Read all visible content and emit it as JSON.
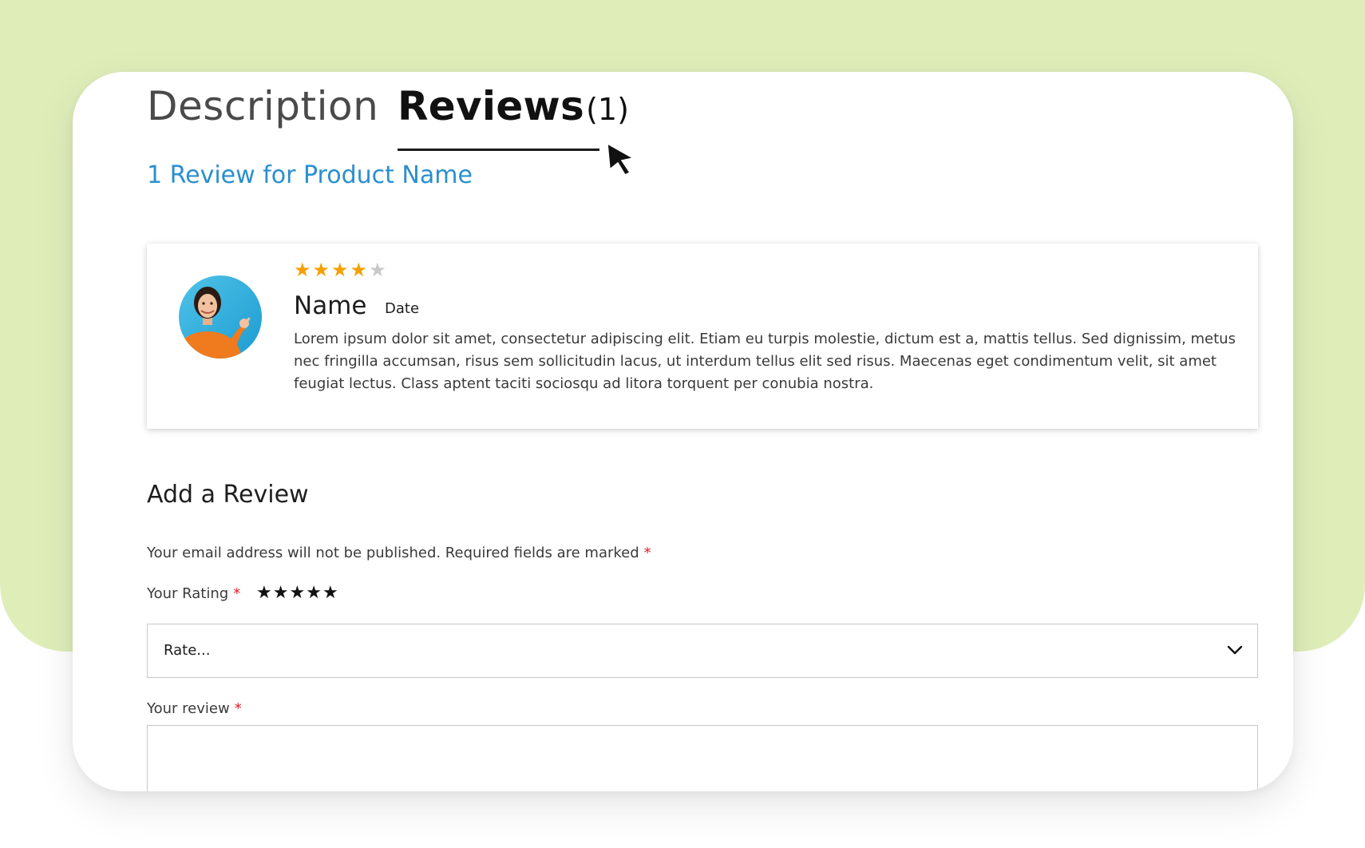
{
  "tabs": {
    "description_label": "Description",
    "reviews_label": "Reviews",
    "reviews_count": "(1)"
  },
  "reviews_section": {
    "title": "1 Review for Product Name"
  },
  "review": {
    "rating": 4,
    "max_rating": 5,
    "name": "Name",
    "date": "Date",
    "text": "Lorem ipsum dolor sit amet, consectetur adipiscing elit. Etiam eu turpis molestie, dictum est a, mattis tellus. Sed dignissim, metus nec fringilla accumsan, risus sem sollicitudin lacus, ut interdum tellus elit sed risus. Maecenas eget condimentum velit, sit amet feugiat lectus. Class aptent taciti sociosqu ad litora torquent per conubia nostra."
  },
  "add_review": {
    "heading": "Add a Review",
    "notice": "Your email address will not be published. Required fields are marked",
    "required_mark": "*",
    "rating_label": "Your Rating",
    "rating_stars": 5,
    "select_value": "Rate...",
    "review_label": "Your review"
  },
  "icons": {
    "cursor": "mouse-pointer-icon",
    "chevron": "chevron-down-icon",
    "star": "star-icon"
  },
  "colors": {
    "background_green": "#dfeeb9",
    "link_blue": "#2a8fcf",
    "star_gold": "#f5a000",
    "required_red": "#e01b22"
  }
}
